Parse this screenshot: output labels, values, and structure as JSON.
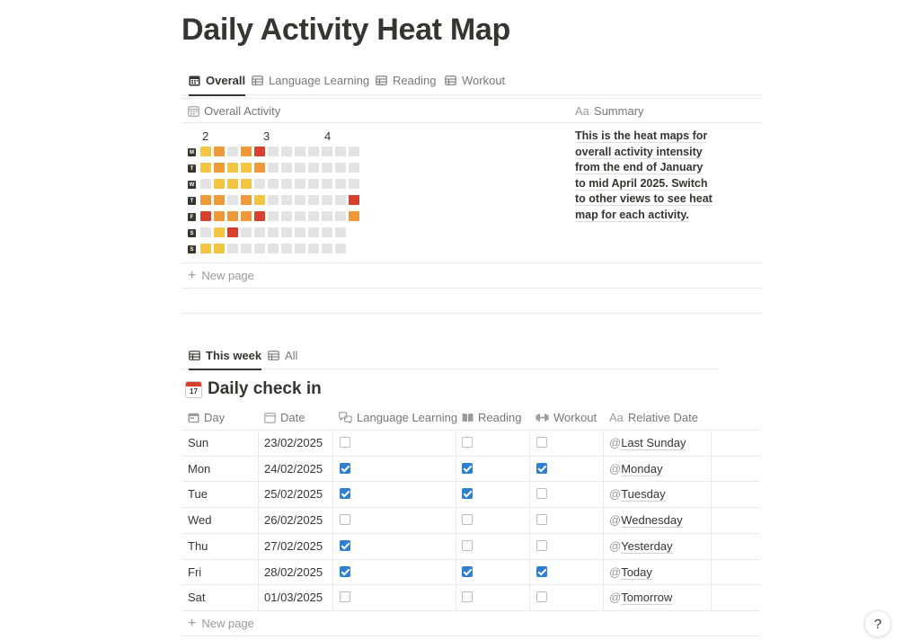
{
  "page": {
    "title": "Daily Activity Heat Map"
  },
  "views_top": {
    "tabs": [
      {
        "label": "Overall",
        "icon": "calendar-icon"
      },
      {
        "label": "Language Learning",
        "icon": "table-icon"
      },
      {
        "label": "Reading",
        "icon": "table-icon"
      },
      {
        "label": "Workout",
        "icon": "table-icon"
      }
    ],
    "active": 0
  },
  "overall_table": {
    "col_activity": "Overall Activity",
    "col_summary_prefix": "Aa",
    "col_summary": "Summary",
    "month_labels": [
      "2",
      "3",
      "4"
    ],
    "day_labels": [
      "M",
      "T",
      "W",
      "T",
      "F",
      "S",
      "S"
    ],
    "heatmap_levels": [
      [
        1,
        2,
        0,
        2,
        3,
        0,
        0,
        0,
        0,
        0,
        0,
        0
      ],
      [
        1,
        2,
        1,
        1,
        2,
        0,
        0,
        0,
        0,
        0,
        0,
        0
      ],
      [
        0,
        1,
        1,
        1,
        0,
        0,
        0,
        0,
        0,
        0,
        0,
        0
      ],
      [
        2,
        2,
        0,
        2,
        1,
        0,
        0,
        0,
        0,
        0,
        0,
        3
      ],
      [
        3,
        2,
        2,
        2,
        3,
        0,
        0,
        0,
        0,
        0,
        0,
        2
      ],
      [
        0,
        1,
        3,
        0,
        0,
        0,
        0,
        0,
        0,
        0,
        0
      ],
      [
        1,
        1,
        0,
        0,
        0,
        0,
        0,
        0,
        0,
        0,
        0
      ]
    ],
    "level_colors": [
      "#e3e3e3",
      "#f3c542",
      "#ef9a3a",
      "#d6402f"
    ],
    "summary_lines": [
      "This is the heat maps for",
      "overall activity intensity",
      "from the end of January",
      "to mid April 2025. Switch",
      "to other views to see heat",
      "map for each activity."
    ],
    "new_page": "New page"
  },
  "views_bottom": {
    "tabs": [
      {
        "label": "This week",
        "icon": "table-icon"
      },
      {
        "label": "All",
        "icon": "table-icon"
      }
    ],
    "active": 0
  },
  "checkin": {
    "title": "Daily check in",
    "emoji_day": "17",
    "headers": {
      "day": "Day",
      "date": "Date",
      "language": "Language Learning",
      "reading": "Reading",
      "workout": "Workout",
      "relative_prefix": "Aa",
      "relative": "Relative Date"
    },
    "rows": [
      {
        "day": "Sun",
        "date": "23/02/2025",
        "language": false,
        "reading": false,
        "workout": false,
        "relative": "Last Sunday"
      },
      {
        "day": "Mon",
        "date": "24/02/2025",
        "language": true,
        "reading": true,
        "workout": true,
        "relative": "Monday"
      },
      {
        "day": "Tue",
        "date": "25/02/2025",
        "language": true,
        "reading": true,
        "workout": false,
        "relative": "Tuesday"
      },
      {
        "day": "Wed",
        "date": "26/02/2025",
        "language": false,
        "reading": false,
        "workout": false,
        "relative": "Wednesday"
      },
      {
        "day": "Thu",
        "date": "27/02/2025",
        "language": true,
        "reading": false,
        "workout": false,
        "relative": "Yesterday"
      },
      {
        "day": "Fri",
        "date": "28/02/2025",
        "language": true,
        "reading": true,
        "workout": true,
        "relative": "Today"
      },
      {
        "day": "Sat",
        "date": "01/03/2025",
        "language": false,
        "reading": false,
        "workout": false,
        "relative": "Tomorrow"
      }
    ],
    "mention_prefix": "@",
    "new_page": "New page"
  },
  "help": {
    "icon": "help-icon",
    "glyph": "?"
  },
  "colors": {
    "checkbox_checked": "#2f7fd1",
    "text": "#37352f",
    "muted": "#787774"
  }
}
